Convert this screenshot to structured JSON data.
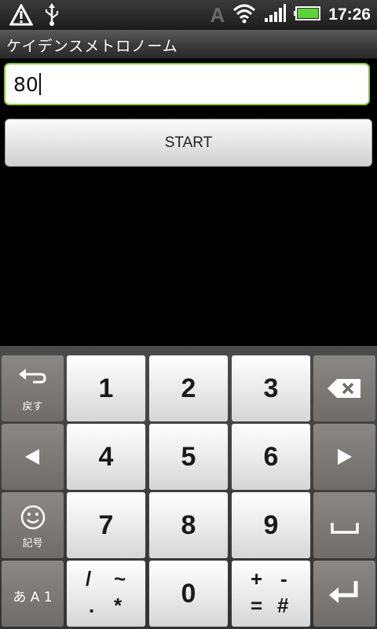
{
  "status_bar": {
    "time": "17:26",
    "a_indicator": "A",
    "icons": [
      "warning-icon",
      "usb-icon",
      "wifi-icon",
      "signal-icon",
      "battery-icon"
    ]
  },
  "app": {
    "title": "ケイデンスメトロノーム"
  },
  "bpm_input": {
    "value": "80"
  },
  "start_button": {
    "label": "START"
  },
  "keyboard": {
    "back_label": "戻す",
    "emoji_label": "記号",
    "mode_label": "あ A 1",
    "keys": {
      "k1": "1",
      "k2": "2",
      "k3": "3",
      "k4": "4",
      "k5": "5",
      "k6": "6",
      "k7": "7",
      "k8": "8",
      "k9": "9",
      "k0": "0"
    },
    "symbols_left": [
      "/",
      "~",
      ".",
      "*"
    ],
    "symbols_right": [
      "+",
      "-",
      "=",
      "#"
    ]
  },
  "colors": {
    "accent_focus": "#88c43d",
    "battery": "#5bd235"
  }
}
